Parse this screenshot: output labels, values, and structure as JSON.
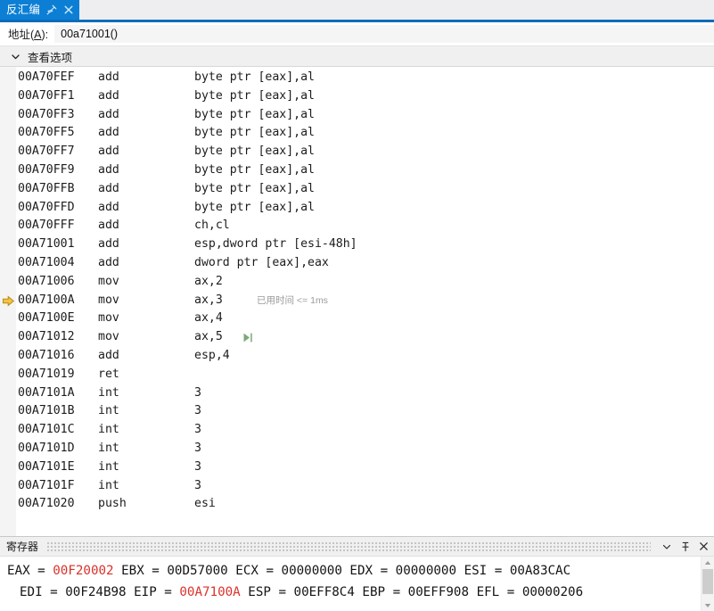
{
  "window": {
    "tab": {
      "label": "反汇编",
      "pin_icon": "pin-icon",
      "close_icon": "close-icon"
    }
  },
  "address_bar": {
    "label_prefix": "地址(",
    "label_accel": "A",
    "label_suffix": "):",
    "value": "00a71001()",
    "placeholder": "地址"
  },
  "view_options": {
    "chevron_icon": "chevron-down-icon",
    "label": "查看选项"
  },
  "disassembly": {
    "eip_address": "00A7100A",
    "eip_marker_icon": "yellow-arrow-icon",
    "run_to_cursor_icon": "run-to-cursor-icon",
    "lines": [
      {
        "address": "00A70FEF",
        "mnemonic": "add",
        "operands": "byte ptr [eax],al"
      },
      {
        "address": "00A70FF1",
        "mnemonic": "add",
        "operands": "byte ptr [eax],al"
      },
      {
        "address": "00A70FF3",
        "mnemonic": "add",
        "operands": "byte ptr [eax],al"
      },
      {
        "address": "00A70FF5",
        "mnemonic": "add",
        "operands": "byte ptr [eax],al"
      },
      {
        "address": "00A70FF7",
        "mnemonic": "add",
        "operands": "byte ptr [eax],al"
      },
      {
        "address": "00A70FF9",
        "mnemonic": "add",
        "operands": "byte ptr [eax],al"
      },
      {
        "address": "00A70FFB",
        "mnemonic": "add",
        "operands": "byte ptr [eax],al"
      },
      {
        "address": "00A70FFD",
        "mnemonic": "add",
        "operands": "byte ptr [eax],al"
      },
      {
        "address": "00A70FFF",
        "mnemonic": "add",
        "operands": "ch,cl"
      },
      {
        "address": "00A71001",
        "mnemonic": "add",
        "operands": "esp,dword ptr [esi-48h]"
      },
      {
        "address": "00A71004",
        "mnemonic": "add",
        "operands": "dword ptr [eax],eax"
      },
      {
        "address": "00A71006",
        "mnemonic": "mov",
        "operands": "ax,2"
      },
      {
        "address": "00A7100A",
        "mnemonic": "mov",
        "operands": "ax,3",
        "current": true,
        "note": "已用时间 <= 1ms"
      },
      {
        "address": "00A7100E",
        "mnemonic": "mov",
        "operands": "ax,4"
      },
      {
        "address": "00A71012",
        "mnemonic": "mov",
        "operands": "ax,5",
        "run_marker": true
      },
      {
        "address": "00A71016",
        "mnemonic": "add",
        "operands": "esp,4"
      },
      {
        "address": "00A71019",
        "mnemonic": "ret",
        "operands": ""
      },
      {
        "address": "00A7101A",
        "mnemonic": "int",
        "operands": "3"
      },
      {
        "address": "00A7101B",
        "mnemonic": "int",
        "operands": "3"
      },
      {
        "address": "00A7101C",
        "mnemonic": "int",
        "operands": "3"
      },
      {
        "address": "00A7101D",
        "mnemonic": "int",
        "operands": "3"
      },
      {
        "address": "00A7101E",
        "mnemonic": "int",
        "operands": "3"
      },
      {
        "address": "00A7101F",
        "mnemonic": "int",
        "operands": "3"
      },
      {
        "address": "00A71020",
        "mnemonic": "push",
        "operands": "esi"
      }
    ]
  },
  "registers": {
    "title": "寄存器",
    "dropdown_icon": "chevron-down-icon",
    "pin_icon": "pin-icon",
    "close_icon": "close-icon",
    "changed_color": "#d9322c",
    "rows": [
      [
        {
          "name": "EAX",
          "value": "00F20002",
          "changed": true
        },
        {
          "name": "EBX",
          "value": "00D57000",
          "changed": false
        },
        {
          "name": "ECX",
          "value": "00000000",
          "changed": false
        },
        {
          "name": "EDX",
          "value": "00000000",
          "changed": false
        },
        {
          "name": "ESI",
          "value": "00A83CAC",
          "changed": false
        }
      ],
      [
        {
          "name": "EDI",
          "value": "00F24B98",
          "changed": false
        },
        {
          "name": "EIP",
          "value": "00A7100A",
          "changed": true
        },
        {
          "name": "ESP",
          "value": "00EFF8C4",
          "changed": false
        },
        {
          "name": "EBP",
          "value": "00EFF908",
          "changed": false
        },
        {
          "name": "EFL",
          "value": "00000206",
          "changed": false
        }
      ]
    ]
  }
}
